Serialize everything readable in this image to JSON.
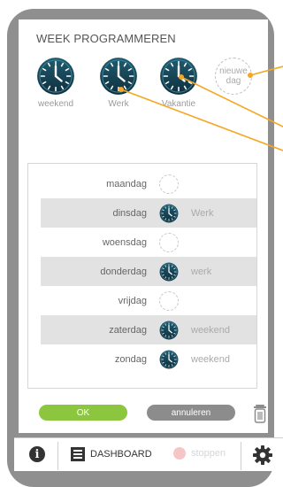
{
  "header": {
    "title": "WEEK PROGRAMMEREN"
  },
  "programs": [
    {
      "label": "weekend"
    },
    {
      "label": "Werk"
    },
    {
      "label": "Vakantie"
    }
  ],
  "new_day": {
    "line1": "nieuwe",
    "line2": "dag"
  },
  "days": [
    {
      "name": "maandag",
      "program": ""
    },
    {
      "name": "dinsdag",
      "program": "Werk"
    },
    {
      "name": "woensdag",
      "program": ""
    },
    {
      "name": "donderdag",
      "program": "werk"
    },
    {
      "name": "vrijdag",
      "program": ""
    },
    {
      "name": "zaterdag",
      "program": "weekend"
    },
    {
      "name": "zondag",
      "program": "weekend"
    }
  ],
  "buttons": {
    "ok": "OK",
    "cancel": "annuleren"
  },
  "bottom_bar": {
    "dashboard": "DASHBOARD",
    "stop": "stoppen"
  },
  "colors": {
    "ok": "#8cc63f",
    "cancel": "#8c8c8c",
    "callout": "#f5a623",
    "clock_dark": "#1b4a5c"
  },
  "icons": [
    "clock-icon",
    "trash-icon",
    "info-icon",
    "dashboard-icon",
    "stop-icon",
    "gear-icon"
  ]
}
